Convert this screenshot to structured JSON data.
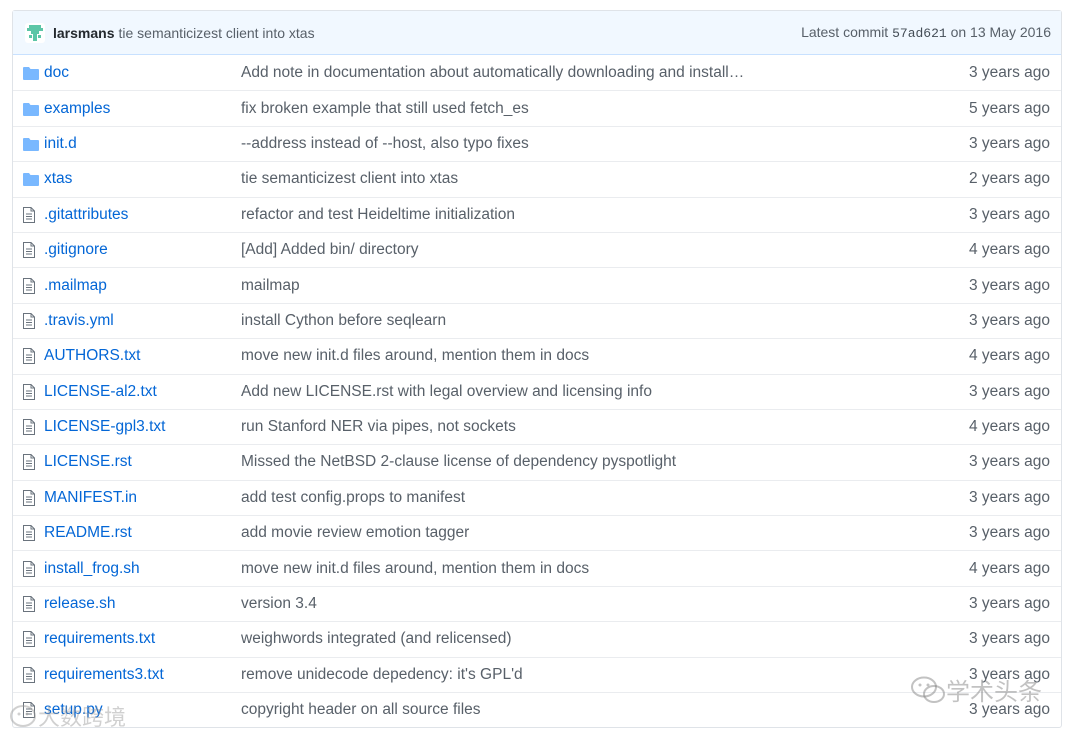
{
  "commit": {
    "author": "larsmans",
    "message": "tie semanticizest client into xtas",
    "latest_label": "Latest commit",
    "sha": "57ad621",
    "date": "on 13 May 2016"
  },
  "files": [
    {
      "type": "folder",
      "name": "doc",
      "message": "Add note in documentation about automatically downloading and install…",
      "age": "3 years ago"
    },
    {
      "type": "folder",
      "name": "examples",
      "message": "fix broken example that still used fetch_es",
      "age": "5 years ago"
    },
    {
      "type": "folder",
      "name": "init.d",
      "message": "--address instead of --host, also typo fixes",
      "age": "3 years ago"
    },
    {
      "type": "folder",
      "name": "xtas",
      "message": "tie semanticizest client into xtas",
      "age": "2 years ago"
    },
    {
      "type": "file",
      "name": ".gitattributes",
      "message": "refactor and test Heideltime initialization",
      "age": "3 years ago"
    },
    {
      "type": "file",
      "name": ".gitignore",
      "message": "[Add] Added bin/ directory",
      "age": "4 years ago"
    },
    {
      "type": "file",
      "name": ".mailmap",
      "message": "mailmap",
      "age": "3 years ago"
    },
    {
      "type": "file",
      "name": ".travis.yml",
      "message": "install Cython before seqlearn",
      "age": "3 years ago"
    },
    {
      "type": "file",
      "name": "AUTHORS.txt",
      "message": "move new init.d files around, mention them in docs",
      "age": "4 years ago"
    },
    {
      "type": "file",
      "name": "LICENSE-al2.txt",
      "message": "Add new LICENSE.rst with legal overview and licensing info",
      "age": "3 years ago"
    },
    {
      "type": "file",
      "name": "LICENSE-gpl3.txt",
      "message": "run Stanford NER via pipes, not sockets",
      "age": "4 years ago"
    },
    {
      "type": "file",
      "name": "LICENSE.rst",
      "message": "Missed the NetBSD 2-clause license of dependency pyspotlight",
      "age": "3 years ago"
    },
    {
      "type": "file",
      "name": "MANIFEST.in",
      "message": "add test config.props to manifest",
      "age": "3 years ago"
    },
    {
      "type": "file",
      "name": "README.rst",
      "message": "add movie review emotion tagger",
      "age": "3 years ago"
    },
    {
      "type": "file",
      "name": "install_frog.sh",
      "message": "move new init.d files around, mention them in docs",
      "age": "4 years ago"
    },
    {
      "type": "file",
      "name": "release.sh",
      "message": "version 3.4",
      "age": "3 years ago"
    },
    {
      "type": "file",
      "name": "requirements.txt",
      "message": "weighwords integrated (and relicensed)",
      "age": "3 years ago"
    },
    {
      "type": "file",
      "name": "requirements3.txt",
      "message": "remove unidecode depedency: it's GPL'd",
      "age": "3 years ago"
    },
    {
      "type": "file",
      "name": "setup.py",
      "message": "copyright header on all source files",
      "age": "3 years ago"
    }
  ],
  "watermarks": {
    "right": "学术头条",
    "left": "大数跨境"
  },
  "colors": {
    "link": "#0366d6",
    "folder_icon": "#79b8ff",
    "file_icon": "#6a737d",
    "commit_bar": "#f1f8ff"
  }
}
